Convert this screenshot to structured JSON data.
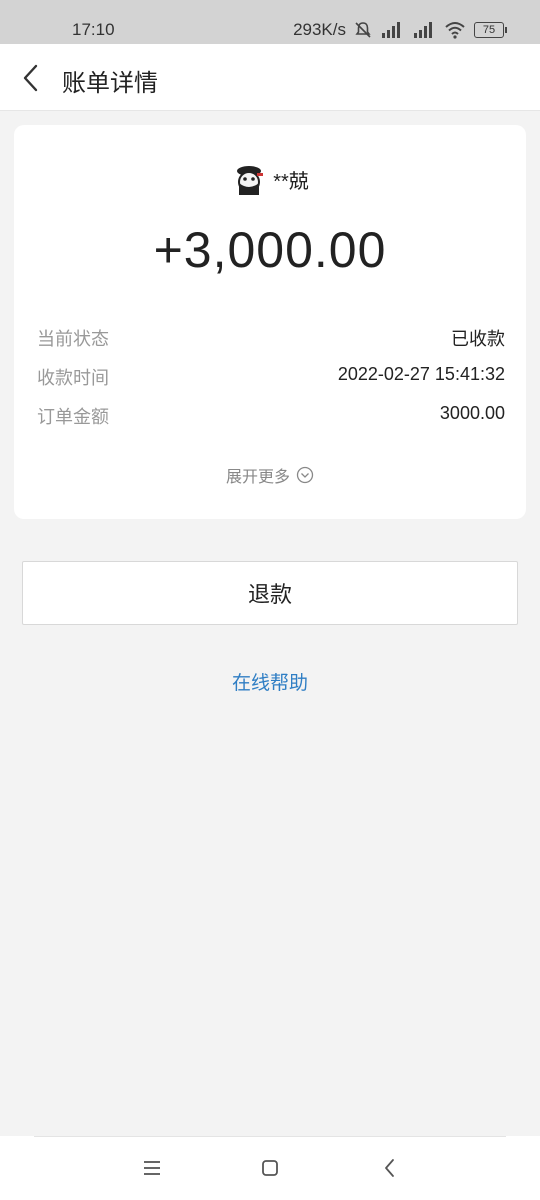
{
  "status_bar": {
    "time": "17:10",
    "network_speed": "293K/s",
    "battery": "75"
  },
  "header": {
    "title": "账单详情",
    "back_icon": "chevron-left-icon"
  },
  "card": {
    "payer_name": "**兢",
    "amount": "+3,000.00",
    "rows": [
      {
        "label": "当前状态",
        "value": "已收款"
      },
      {
        "label": "收款时间",
        "value": "2022-02-27 15:41:32"
      },
      {
        "label": "订单金额",
        "value": "3000.00"
      }
    ],
    "expand_label": "展开更多"
  },
  "actions": {
    "refund_label": "退款",
    "help_label": "在线帮助"
  },
  "colors": {
    "link": "#2f7ec4",
    "background": "#f3f3f3"
  }
}
